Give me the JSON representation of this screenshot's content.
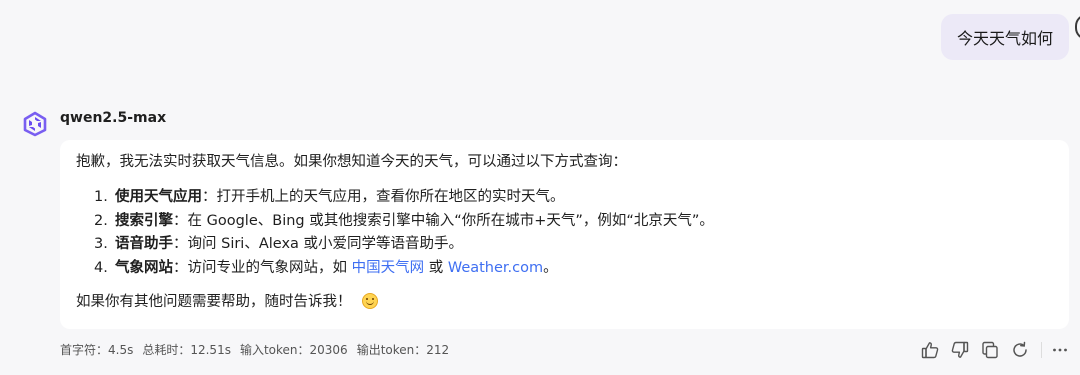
{
  "user_message": "今天天气如何",
  "assistant": {
    "model_name": "qwen2.5-max",
    "intro": "抱歉，我无法实时获取天气信息。如果你想知道今天的天气，可以通过以下方式查询：",
    "steps": [
      {
        "num": "1.",
        "title": "使用天气应用",
        "text": "：打开手机上的天气应用，查看你所在地区的实时天气。"
      },
      {
        "num": "2.",
        "title": "搜索引擎",
        "text": "：在 Google、Bing 或其他搜索引擎中输入“你所在城市+天气”，例如“北京天气”。"
      },
      {
        "num": "3.",
        "title": "语音助手",
        "text": "：询问 Siri、Alexa 或小爱同学等语音助手。"
      },
      {
        "num": "4.",
        "title": "气象网站",
        "text_before": "：访问专业的气象网站，如 ",
        "link1": "中国天气网",
        "text_middle": " 或 ",
        "link2": "Weather.com",
        "text_after": "。"
      }
    ],
    "closing": "如果你有其他问题需要帮助，随时告诉我！"
  },
  "stats": {
    "first_token": "首字符：4.5s",
    "total_time": "总耗时：12.51s",
    "input_tokens": "输入token：20306",
    "output_tokens": "输出token：212"
  },
  "actions": {
    "icons": [
      "thumbs-up-icon",
      "thumbs-down-icon",
      "copy-icon",
      "refresh-icon",
      "more-icon"
    ]
  },
  "colors": {
    "background": "#f7f7f9",
    "user_bubble": "#ece9f7",
    "card": "#ffffff",
    "link": "#3f6ff2",
    "logo": "#6a4cf0"
  }
}
